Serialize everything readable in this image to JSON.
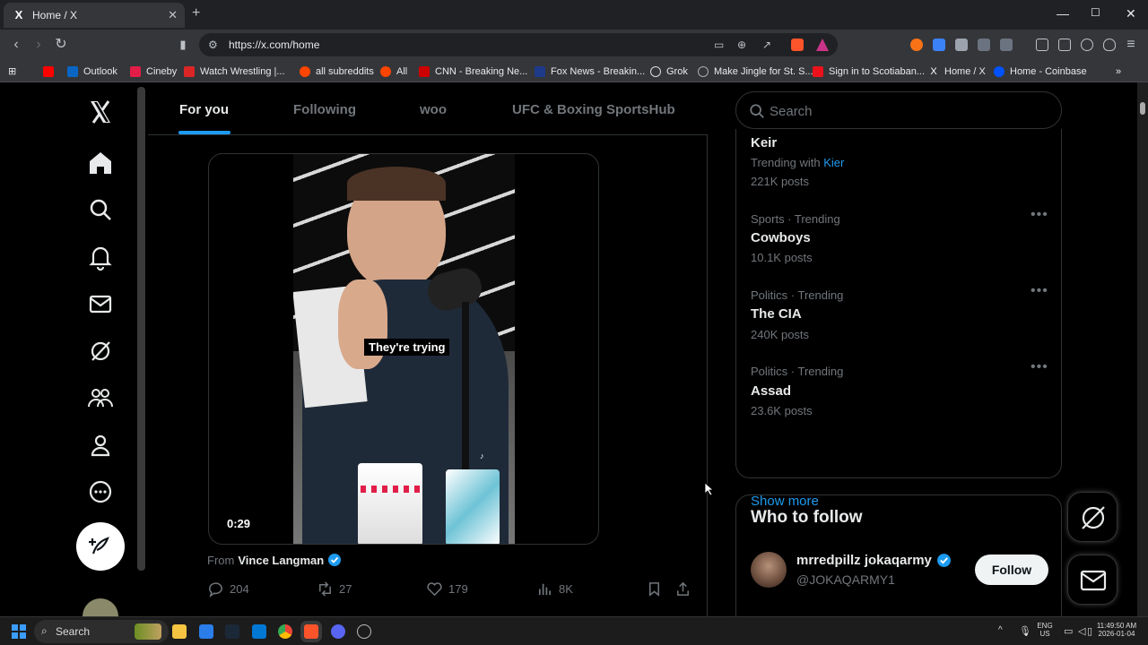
{
  "browser": {
    "tab_title": "Home / X",
    "tab_favicon": "X",
    "url": "https://x.com/home",
    "bookmarks": [
      {
        "label": "Outlook",
        "icon": "outlook-icon",
        "color": "#0a66c2"
      },
      {
        "label": "Cineby",
        "icon": "cineby-icon",
        "color": "#e11d48"
      },
      {
        "label": "Watch Wrestling |...",
        "icon": "wrestling-icon",
        "color": "#dc2626"
      },
      {
        "label": "all subreddits",
        "icon": "reddit-icon",
        "color": "#ff4500"
      },
      {
        "label": "All",
        "icon": "reddit-icon",
        "color": "#ff4500"
      },
      {
        "label": "CNN - Breaking Ne...",
        "icon": "cnn-icon",
        "color": "#cc0000"
      },
      {
        "label": "Fox News - Breakin...",
        "icon": "fox-icon",
        "color": "#1e3a8a"
      },
      {
        "label": "Grok",
        "icon": "grok-icon",
        "color": "#dddddd"
      },
      {
        "label": "Make Jingle for St. S...",
        "icon": "jingle-icon",
        "color": "#aaaaaa"
      },
      {
        "label": "Sign in to Scotiaban...",
        "icon": "scotia-icon",
        "color": "#ec111a"
      },
      {
        "label": "Home / X",
        "icon": "x-icon",
        "color": "#ffffff"
      },
      {
        "label": "Home - Coinbase",
        "icon": "coinbase-icon",
        "color": "#0052ff"
      }
    ]
  },
  "feed_tabs": [
    {
      "label": "For you",
      "active": true
    },
    {
      "label": "Following",
      "active": false
    },
    {
      "label": "woo",
      "active": false
    },
    {
      "label": "UFC & Boxing SportsHub",
      "active": false
    }
  ],
  "post": {
    "video_caption": "They're trying",
    "video_duration": "0:29",
    "from_prefix": "From",
    "from_name": "Vince Langman",
    "verified": true,
    "actions": {
      "replies": "204",
      "reposts": "27",
      "likes": "179",
      "views": "8K"
    }
  },
  "sidebar": {
    "search_placeholder": "Search",
    "trends": [
      {
        "meta": "",
        "title": "Keir",
        "trending_with_label": "Trending with",
        "trending_with_value": "Kier",
        "posts": "221K posts"
      },
      {
        "meta": "Sports · Trending",
        "title": "Cowboys",
        "posts": "10.1K posts"
      },
      {
        "meta": "Politics · Trending",
        "title": "The CIA",
        "posts": "240K posts"
      },
      {
        "meta": "Politics · Trending",
        "title": "Assad",
        "posts": "23.6K posts"
      }
    ],
    "show_more": "Show more",
    "who_to_follow": {
      "title": "Who to follow",
      "name": "mrredpillz jokaqarmy",
      "handle": "@JOKAQARMY1",
      "follow_label": "Follow"
    }
  },
  "taskbar": {
    "search_label": "Search",
    "lang_top": "ENG",
    "lang_bottom": "US",
    "time": "11:49:50 AM",
    "date": "2026-01-04"
  },
  "colors": {
    "accent": "#1d9bf0",
    "muted": "#71767b",
    "text": "#e7e9ea",
    "border": "#2f3336"
  }
}
